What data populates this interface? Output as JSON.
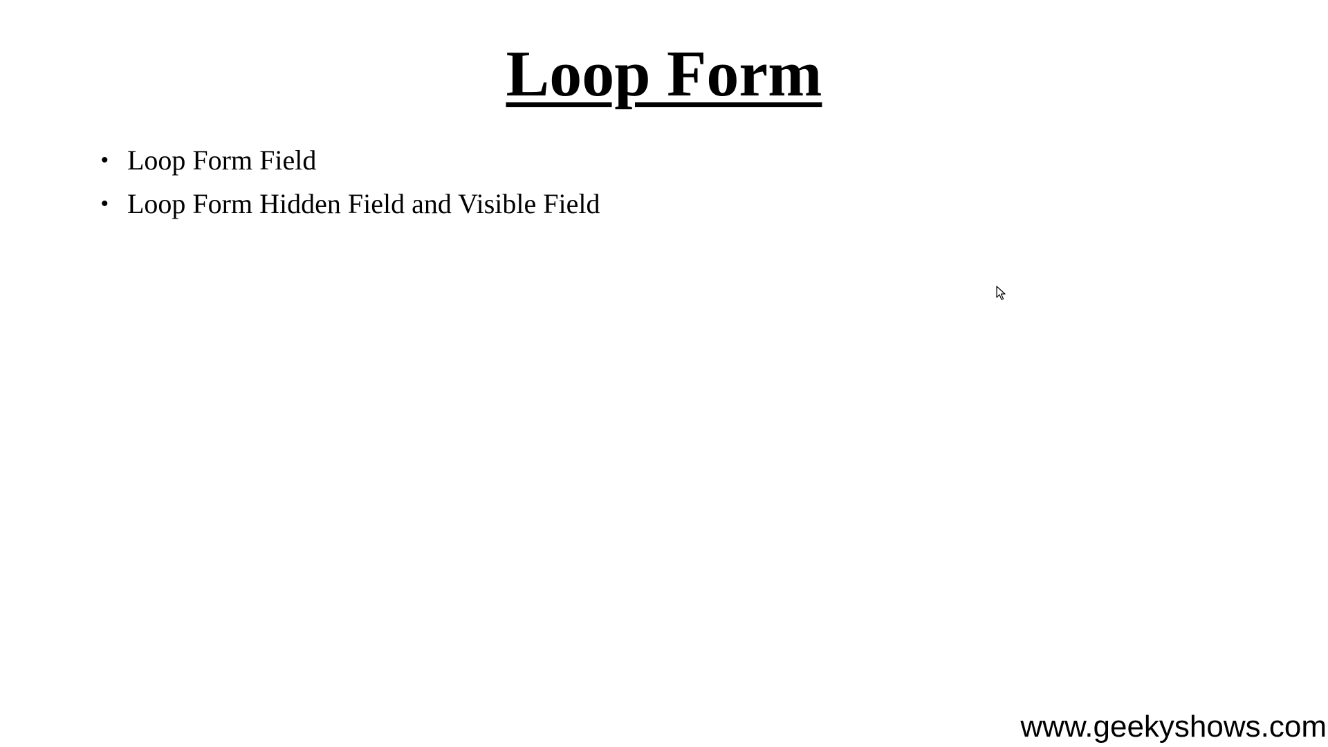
{
  "slide": {
    "title": "Loop Form",
    "bullets": [
      "Loop Form Field",
      "Loop Form Hidden Field and Visible Field"
    ],
    "bullet_glyph": "•",
    "watermark": "www.geekyshows.com"
  },
  "cursor": {
    "icon": "mouse-pointer-icon"
  },
  "colors": {
    "background": "#ffffff",
    "text": "#000000"
  }
}
